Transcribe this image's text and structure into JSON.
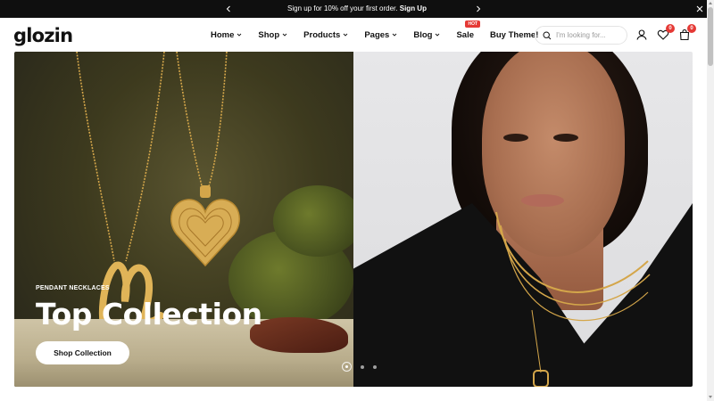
{
  "announcement": {
    "text": "Sign up for 10% off your first order.",
    "link": "Sign Up",
    "prev_icon": "chevron-left-icon",
    "next_icon": "chevron-right-icon",
    "close_icon": "close-icon"
  },
  "header": {
    "logo": "glozin",
    "nav": [
      {
        "label": "Home",
        "dropdown": true
      },
      {
        "label": "Shop",
        "dropdown": true
      },
      {
        "label": "Products",
        "dropdown": true
      },
      {
        "label": "Pages",
        "dropdown": true
      },
      {
        "label": "Blog",
        "dropdown": true
      },
      {
        "label": "Sale",
        "dropdown": false,
        "badge": "HOT"
      },
      {
        "label": "Buy Theme!",
        "dropdown": false
      }
    ],
    "search": {
      "placeholder": "I'm looking for..."
    },
    "wishlist_count": "0",
    "cart_count": "0"
  },
  "hero": {
    "eyebrow": "PENDANT NECKLACES",
    "headline": "Top Collection",
    "cta": "Shop Collection",
    "slides": 3,
    "active_slide": 1
  },
  "colors": {
    "topbar_bg": "#0f0f0f",
    "badge": "#e53935",
    "accent_gold": "#d4a64a"
  }
}
